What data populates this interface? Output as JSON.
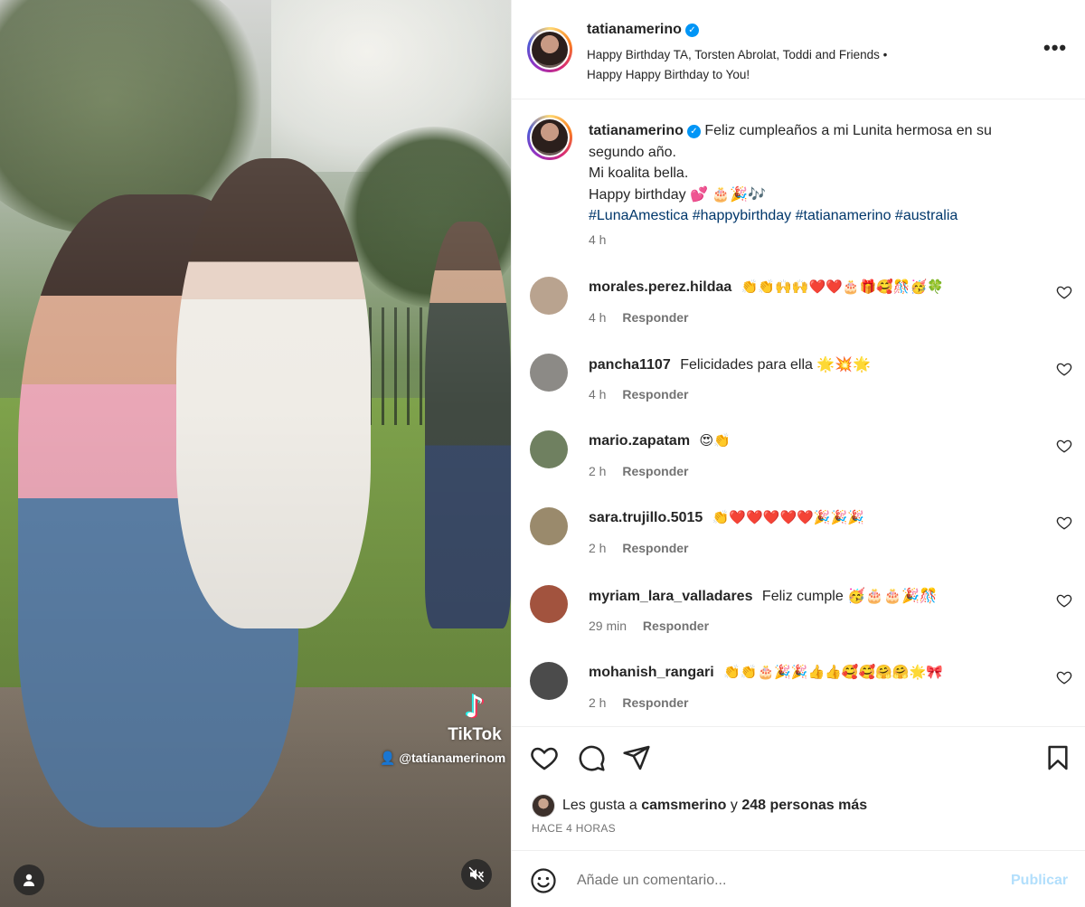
{
  "post": {
    "author": "tatianamerino",
    "audio_line_1": "Happy Birthday TA, Torsten Abrolat, Toddi and Friends •",
    "audio_line_2": "Happy Happy Birthday to You!",
    "caption_line_1": "Feliz cumpleaños a mi Lunita hermosa en su",
    "caption_line_2": "segundo año.",
    "caption_line_3": "Mi koalita bella.",
    "caption_line_4": "Happy birthday 💕 🎂🎉🎶",
    "hashtags": [
      "#LunaAmestica",
      "#happybirthday",
      "#tatianamerino",
      "#australia"
    ],
    "caption_time": "4 h"
  },
  "media": {
    "watermark_logo": "TikTok",
    "watermark_handle": "@tatianamerinom",
    "icons": [
      "user-tag-icon",
      "mute-icon"
    ]
  },
  "comments": [
    {
      "user": "morales.perez.hildaa",
      "text": "👏👏🙌🙌❤️❤️🎂🎁🥰🎊🥳🍀",
      "time": "4 h",
      "reply": "Responder",
      "avatar_color": "#b9a38f"
    },
    {
      "user": "pancha1107",
      "text": "Felicidades para ella 🌟💥🌟",
      "time": "4 h",
      "reply": "Responder",
      "avatar_color": "#8c8a86"
    },
    {
      "user": "mario.zapatam",
      "text": "😍👏",
      "time": "2 h",
      "reply": "Responder",
      "avatar_color": "#6f8060"
    },
    {
      "user": "sara.trujillo.5015",
      "text": "👏❤️❤️❤️❤️❤️🎉🎉🎉",
      "time": "2 h",
      "reply": "Responder",
      "avatar_color": "#9a8a6c"
    },
    {
      "user": "myriam_lara_valladares",
      "text": "Feliz cumple 🥳🎂🎂🎉🎊",
      "time": "29 min",
      "reply": "Responder",
      "avatar_color": "#a2533e"
    },
    {
      "user": "mohanish_rangari",
      "text": "👏👏🎂🎉🎉👍👍🥰🥰🤗🤗🌟🎀",
      "time": "2 h",
      "reply": "Responder",
      "avatar_color": "#4b4b4b"
    }
  ],
  "likes": {
    "prefix": "Les gusta a",
    "user": "camsmerino",
    "joiner": "y",
    "others": "248 personas más"
  },
  "posted_ago": "HACE 4 HORAS",
  "comment_input": {
    "placeholder": "Añade un comentario...",
    "publish_label": "Publicar"
  },
  "colors": {
    "link": "#00376b",
    "verified": "#0095f6",
    "publish_disabled": "#b2dffc",
    "muted_text": "#737373"
  }
}
